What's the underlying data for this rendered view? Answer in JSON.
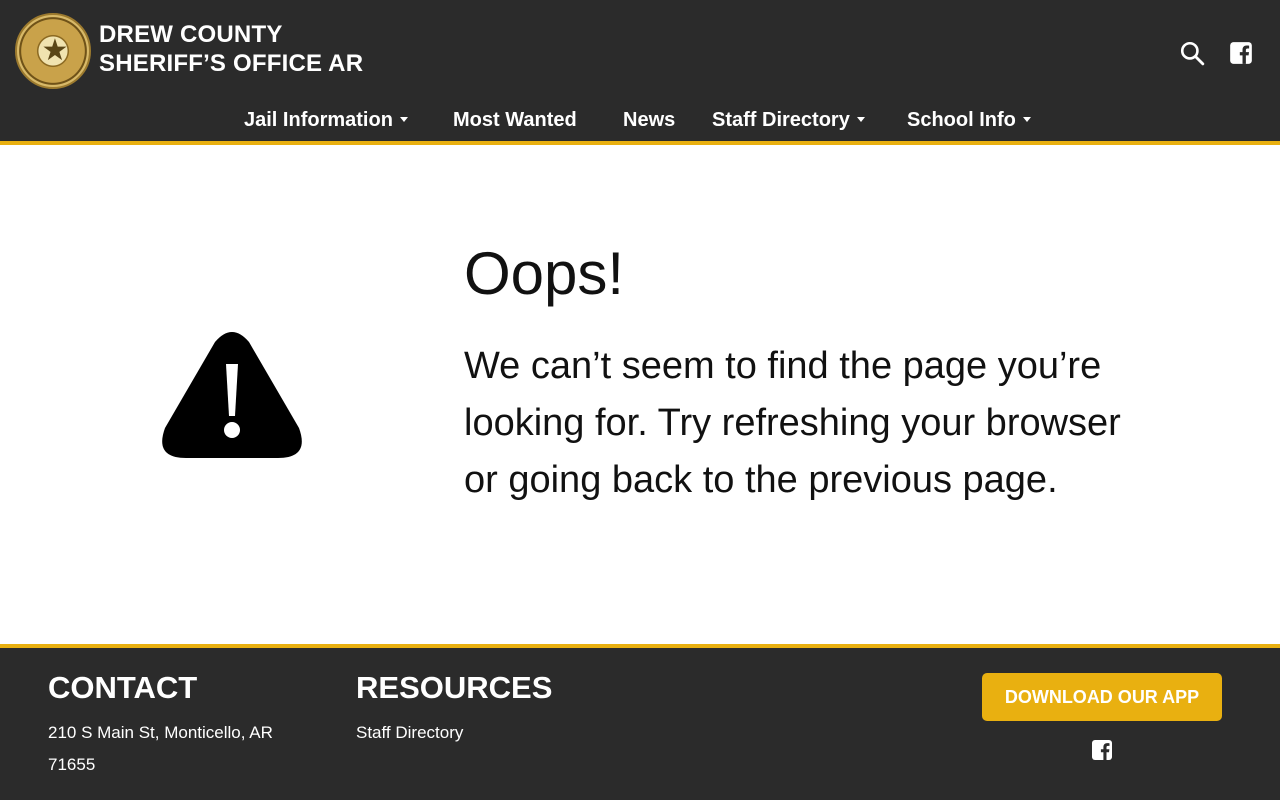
{
  "header": {
    "title_line1": "DREW COUNTY",
    "title_line2": "SHERIFF’S OFFICE AR",
    "logo": "sheriff-badge-seal",
    "icons": [
      "search-icon",
      "facebook-icon"
    ]
  },
  "nav": {
    "items": [
      {
        "label": "Jail Information",
        "dropdown": true
      },
      {
        "label": "Most Wanted",
        "dropdown": false
      },
      {
        "label": "News",
        "dropdown": false
      },
      {
        "label": "Staff Directory",
        "dropdown": true
      },
      {
        "label": "School Info",
        "dropdown": true
      }
    ]
  },
  "main": {
    "heading": "Oops!",
    "message": "We can’t seem to find the page you’re looking for. Try refreshing your browser or going back to the previous page.",
    "icon": "warning-icon"
  },
  "footer": {
    "contact_heading": "CONTACT",
    "address_line1": "210 S Main St, Monticello, AR",
    "address_line2": "71655",
    "resources_heading": "RESOURCES",
    "resources_link": "Staff Directory",
    "app_button": "DOWNLOAD OUR APP",
    "icon": "facebook-icon"
  },
  "colors": {
    "header_bg": "#2b2b2b",
    "accent": "#e9b010",
    "text_dark": "#111111",
    "text_light": "#ffffff"
  }
}
